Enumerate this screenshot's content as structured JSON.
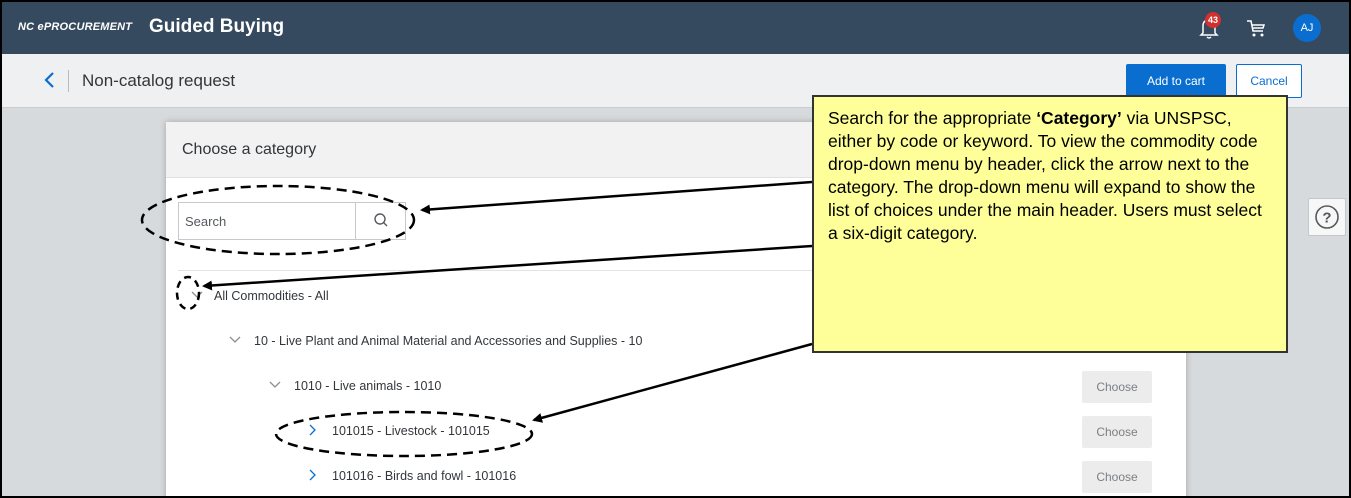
{
  "topbar": {
    "brand": "NC ePROCUREMENT",
    "title": "Guided Buying",
    "notification_count": "43",
    "avatar_initials": "AJ"
  },
  "subbar": {
    "title": "Non-catalog request",
    "add_to_cart": "Add to cart",
    "cancel": "Cancel"
  },
  "dialog": {
    "title": "Choose a category",
    "search_placeholder": "Search",
    "tree": [
      {
        "label": "All Commodities - All",
        "expanded": true,
        "level": 0
      },
      {
        "label": "10 - Live Plant and Animal Material and Accessories and Supplies - 10",
        "expanded": true,
        "level": 1
      },
      {
        "label": "1010 - Live animals - 1010",
        "expanded": true,
        "level": 2,
        "action": "Choose"
      },
      {
        "label": "101015 - Livestock - 101015",
        "expanded": false,
        "level": 3,
        "action": "Choose"
      },
      {
        "label": "101016 - Birds and fowl - 101016",
        "expanded": false,
        "level": 3,
        "action": "Choose"
      }
    ]
  },
  "callout": {
    "line1_prefix": "Search for the appropriate ",
    "line1_bold": "‘Category’",
    "rest": "via UNSPSC, either by code or keyword. To view the commodity code drop-down menu by header, click the arrow next to the category.  The drop-down menu will expand to show the list of choices under the main header.  Users must select a six-digit category."
  },
  "help_icon": "question-icon",
  "colors": {
    "topbar": "#354a5f",
    "accent": "#0a6ed1",
    "callout_bg": "#ffff99",
    "badge": "#d32f2f"
  }
}
